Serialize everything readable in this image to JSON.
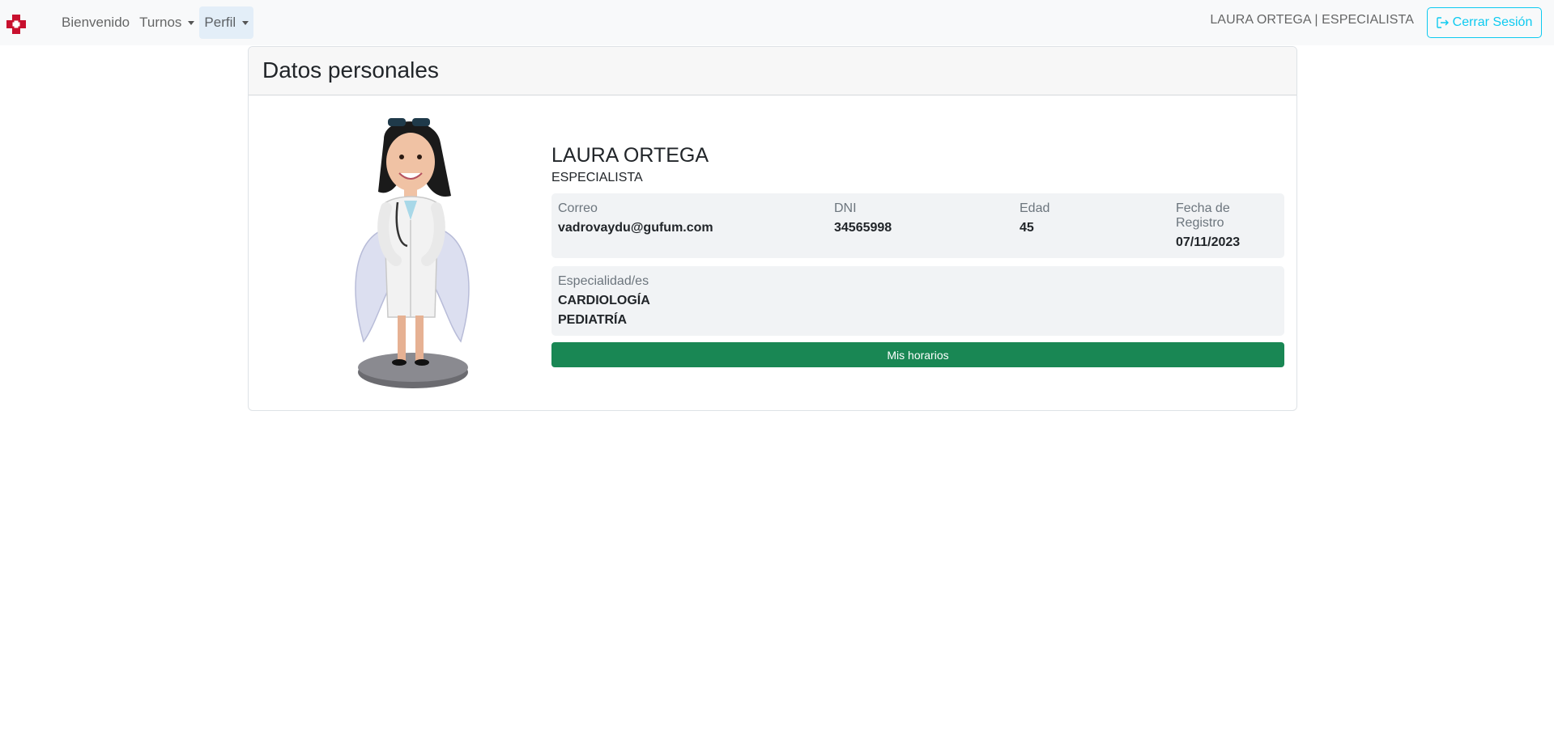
{
  "nav": {
    "links": [
      {
        "label": "Bienvenido"
      },
      {
        "label": "Turnos"
      },
      {
        "label": "Perfil"
      }
    ],
    "user_label": "LAURA ORTEGA | ESPECIALISTA",
    "logout_label": "Cerrar Sesión"
  },
  "card": {
    "title": "Datos personales"
  },
  "profile": {
    "name": "LAURA ORTEGA",
    "role": "ESPECIALISTA",
    "fields": {
      "email_label": "Correo",
      "email_value": "vadrovaydu@gufum.com",
      "dni_label": "DNI",
      "dni_value": "34565998",
      "age_label": "Edad",
      "age_value": "45",
      "reg_label": "Fecha de Registro",
      "reg_value": "07/11/2023"
    },
    "specialties_label": "Especialidad/es",
    "specialties": [
      "CARDIOLOGÍA",
      "PEDIATRÍA"
    ],
    "schedule_button": "Mis horarios"
  },
  "colors": {
    "brand_red": "#c8102e",
    "success": "#198754",
    "info": "#0dcaf0"
  }
}
